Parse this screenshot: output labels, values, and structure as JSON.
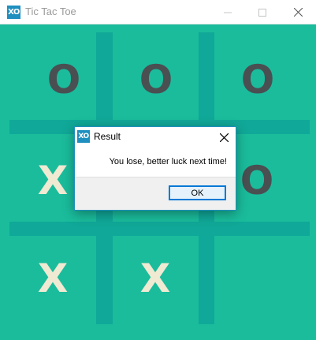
{
  "window": {
    "title": "Tic Tac Toe",
    "icon_text": "XO",
    "controls": [
      "minimize-icon",
      "maximize-icon",
      "close-icon"
    ]
  },
  "board": {
    "cells": [
      [
        "O",
        "O",
        "O"
      ],
      [
        "X",
        "",
        "O"
      ],
      [
        "X",
        "X",
        ""
      ]
    ],
    "colors": {
      "background": "#1abc9c",
      "grid": "#10a898",
      "o_mark": "#4a4f52",
      "x_mark": "#f0ead2"
    }
  },
  "dialog": {
    "title": "Result",
    "icon_text": "XO",
    "message": "You lose, better luck next time!",
    "ok_label": "OK",
    "accent": "#0078d7"
  }
}
